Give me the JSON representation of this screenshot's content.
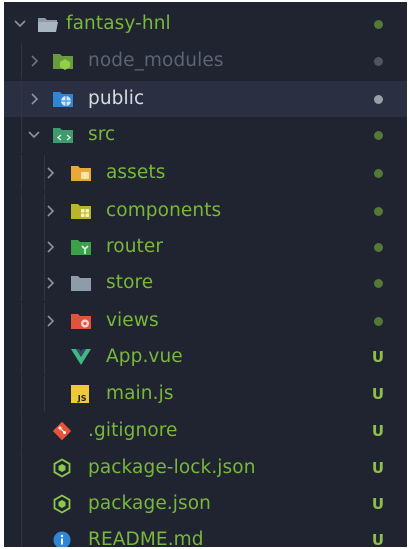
{
  "colors": {
    "background": "#1f2430",
    "highlight": "#2a3042",
    "added_text": "#78b83a",
    "ignored_text": "#5b6472",
    "normal_text": "#d8dce2",
    "dot_added": "#527a35",
    "dot_ignored": "#4e5666",
    "dot_public": "#9a9ea6",
    "status_u": "#8fbf4a"
  },
  "tree": {
    "root": {
      "label": "fantasy-hnl",
      "icon": "folder-open-icon"
    },
    "items": [
      {
        "label": "node_modules",
        "icon": "node-folder-icon",
        "status": "dot",
        "state": "ignored"
      },
      {
        "label": "public",
        "icon": "public-folder-icon",
        "status": "dot",
        "state": "normal"
      },
      {
        "label": "src",
        "icon": "src-folder-icon",
        "status": "dot",
        "state": "added"
      },
      {
        "label": "assets",
        "icon": "assets-folder-icon",
        "status": "dot",
        "state": "added"
      },
      {
        "label": "components",
        "icon": "components-folder-icon",
        "status": "dot",
        "state": "added"
      },
      {
        "label": "router",
        "icon": "router-folder-icon",
        "status": "dot",
        "state": "added"
      },
      {
        "label": "store",
        "icon": "store-folder-icon",
        "status": "dot",
        "state": "added"
      },
      {
        "label": "views",
        "icon": "views-folder-icon",
        "status": "dot",
        "state": "added"
      },
      {
        "label": "App.vue",
        "icon": "vue-icon",
        "status": "U",
        "state": "added"
      },
      {
        "label": "main.js",
        "icon": "javascript-icon",
        "status": "U",
        "state": "added"
      },
      {
        "label": ".gitignore",
        "icon": "git-icon",
        "status": "U",
        "state": "added"
      },
      {
        "label": "package-lock.json",
        "icon": "nodejs-icon",
        "status": "U",
        "state": "added"
      },
      {
        "label": "package.json",
        "icon": "nodejs-icon",
        "status": "U",
        "state": "added"
      },
      {
        "label": "README.md",
        "icon": "info-icon",
        "status": "U",
        "state": "added"
      }
    ]
  }
}
